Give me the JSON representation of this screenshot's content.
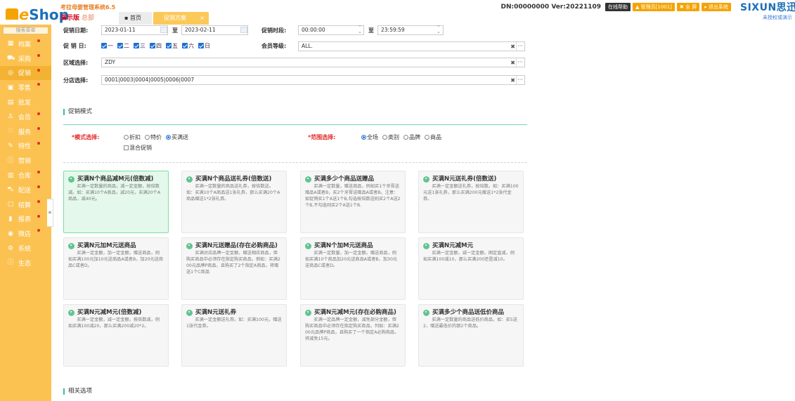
{
  "header": {
    "brand_e": "e",
    "brand_shop": "Shop",
    "system_name": "考拉母婴管理系统6.5",
    "edition": "演示版",
    "location": "总部",
    "tabs": [
      {
        "label": "首页",
        "active": false
      },
      {
        "label": "促销方案",
        "active": true
      }
    ],
    "tab_close": "×",
    "dn_info": "DN:00000000  Ver:20221109",
    "buttons": {
      "help": "在线帮助",
      "admin": "管理员[1001]",
      "fullscreen": "全 屏",
      "exit": "退出系统"
    },
    "brand_right": "SIXUN思迅",
    "unauthorized": "未授权或演示"
  },
  "sidebar": {
    "search_placeholder": "搜索菜单",
    "items": [
      {
        "label": "档案",
        "icon": "archive-icon",
        "dot": true
      },
      {
        "label": "采购",
        "icon": "cart-icon",
        "dot": true
      },
      {
        "label": "促销",
        "icon": "promo-icon",
        "dot": true,
        "active": true
      },
      {
        "label": "零售",
        "icon": "retail-icon",
        "dot": true
      },
      {
        "label": "批发",
        "icon": "wholesale-icon",
        "dot": false
      },
      {
        "label": "会员",
        "icon": "member-icon",
        "dot": true
      },
      {
        "label": "服务",
        "icon": "service-icon",
        "dot": true
      },
      {
        "label": "特性",
        "icon": "feature-icon",
        "dot": true
      },
      {
        "label": "营销",
        "icon": "marketing-icon",
        "dot": false
      },
      {
        "label": "仓库",
        "icon": "warehouse-icon",
        "dot": true
      },
      {
        "label": "配送",
        "icon": "delivery-icon",
        "dot": true
      },
      {
        "label": "结算",
        "icon": "settlement-icon",
        "dot": true
      },
      {
        "label": "报表",
        "icon": "report-icon",
        "dot": true
      },
      {
        "label": "微店",
        "icon": "wechat-shop-icon",
        "dot": true
      },
      {
        "label": "系统",
        "icon": "system-icon",
        "dot": false
      },
      {
        "label": "生态",
        "icon": "ecology-icon",
        "dot": false
      }
    ],
    "collapse_label": "«"
  },
  "form": {
    "date_label": "促销日期:",
    "date_from": "2023-01-11",
    "date_to": "2023-02-11",
    "to_label": "至",
    "time_label": "促销时段:",
    "time_from": "00:00:00",
    "time_to": "23:59:59",
    "weekday_label": "促 销 日:",
    "weekdays": [
      "一",
      "二",
      "三",
      "四",
      "五",
      "六",
      "日"
    ],
    "member_label": "会员等级:",
    "member_value": "ALL.",
    "region_label": "区域选择:",
    "region_value": "ZDY",
    "branch_label": "分店选择:",
    "branch_value": "0001|0003|0004|0005|0006|0007",
    "clear_symbol": "✖",
    "more_symbol": "···"
  },
  "mode_section": {
    "title": "促销模式",
    "mode_label": "*模式选择:",
    "mode_options": [
      "折扣",
      "特价",
      "买满送"
    ],
    "mode_selected": "买满送",
    "mixed_label": "混合促销",
    "scope_label": "*范围选择:",
    "scope_options": [
      "全场",
      "类别",
      "品牌",
      "商品"
    ],
    "scope_selected": "全场"
  },
  "cards": [
    {
      "title": "买满N个商品减M元(倍数减)",
      "desc": "买满一定数量的商品，减一定金额，按倍数减。如：买满10个A商品，减20元，买满20个A商品，减40元。",
      "selected": true
    },
    {
      "title": "买满N个商品送礼券(倍数送)",
      "desc": "买满一定数量的商品送礼券，按倍数送。如：买满10个A商品送1张礼券，那么买满20个A商品赠送1*2张礼券。",
      "selected": false
    },
    {
      "title": "买满多少个商品送赠品",
      "desc": "买满一定数量，赠送商品，例如买1个牙膏送赠品A或者B，买2个牙膏送赠品A或者B。注意：如促销买1个A送1个B,勾选按倍数送则买2个A送2个B,不勾选则买2个A送1个B.",
      "selected": false
    },
    {
      "title": "买满N元送礼券(倍数送)",
      "desc": "买满一定金额送礼券，按倍数。如：买满100元送1张礼券，那么买满200元赠送1*2张代金券。",
      "selected": false
    },
    {
      "title": "买满N元加M元送商品",
      "desc": "买满一定金额，加一定金额，赠送商品，例如买满100元加10元送商品A或者B，加20元送商品C或者D。",
      "selected": false
    },
    {
      "title": "买满N元送赠品(存在必购商品)",
      "desc": "买满对应品牌一定金额，赠送相应商品，但购买商品中必须存在指定购买商品，例如：买满200元品牌P商品，且购买了2个指定A商品，将赠送1个C商品",
      "selected": false
    },
    {
      "title": "买满N个加M元送商品",
      "desc": "买满一定数量，加一定金额，赠送商品，例如买满10个商品加20元送商品A或者B，加30元送商品C或者D。",
      "selected": false
    },
    {
      "title": "买满N元减M元",
      "desc": "买满一定金额，减一定金额，固定直减，例如买满100减10，那么买满200还是减10。",
      "selected": false
    },
    {
      "title": "买满N元减M元(倍数减)",
      "desc": "买满一定金额，减一定金额，按倍数减，例如买满100减20，那么买满200减20*2。",
      "selected": false
    },
    {
      "title": "买满N元送礼券",
      "desc": "买满一定金额送礼券。如：买满100元，赠送1张代金券。",
      "selected": false
    },
    {
      "title": "买满N元减M元(存在必购商品)",
      "desc": "买满一定品牌一定金额，减免部分金额，但购买商品中必须存在指定购买商品，列如：买满200元品牌P商品，且购买了一个指定A必购商品，将减免15元。",
      "selected": false
    },
    {
      "title": "买满多少个商品送低价商品",
      "desc": "买满一定数量的商品送低价商品，如：买5送2，赠送最低价的那2个商品。",
      "selected": false
    }
  ],
  "related_section": {
    "title": "相关选项"
  },
  "colors": {
    "sidebar_bg": "#fcc251",
    "accent_orange": "#f5a300",
    "brand_blue": "#1b6fb8",
    "section_green": "#3bbf8a",
    "card_selected": "#e5f8ec"
  }
}
